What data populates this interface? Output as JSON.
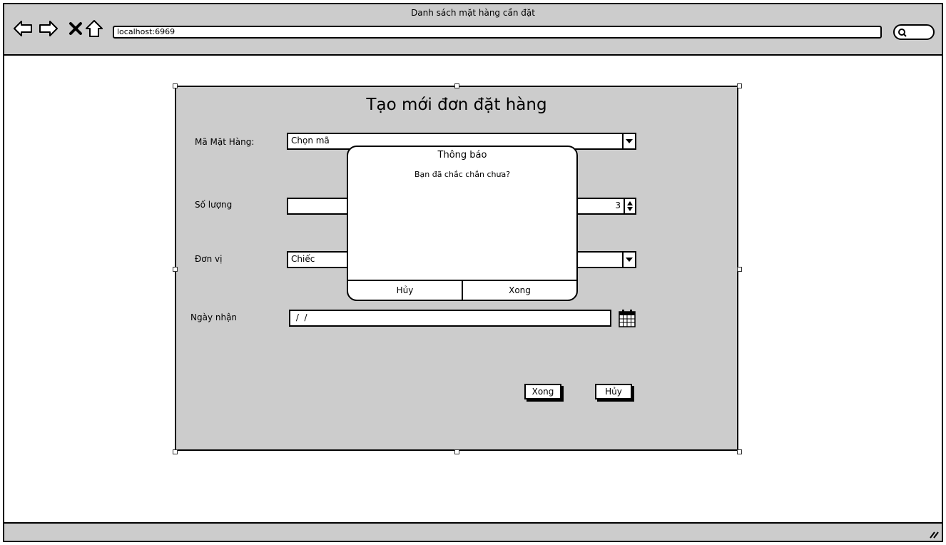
{
  "window": {
    "title": "Danh sách mặt hàng cần đặt"
  },
  "browser": {
    "url": "localhost:6969"
  },
  "form": {
    "title": "Tạo mới đơn đặt hàng",
    "item_code": {
      "label": "Mã Mặt Hàng:",
      "value": "Chọn mã"
    },
    "quantity": {
      "label": "Số lượng",
      "value": "3"
    },
    "unit": {
      "label": "Đơn vị",
      "value": "Chiếc"
    },
    "receive_date": {
      "label": "Ngày nhận",
      "value": " /  /"
    },
    "done_label": "Xong",
    "cancel_label": "Hủy"
  },
  "dialog": {
    "title": "Thông báo",
    "message": "Bạn đã chắc chắn chưa?",
    "cancel_label": "Hủy",
    "done_label": "Xong"
  }
}
